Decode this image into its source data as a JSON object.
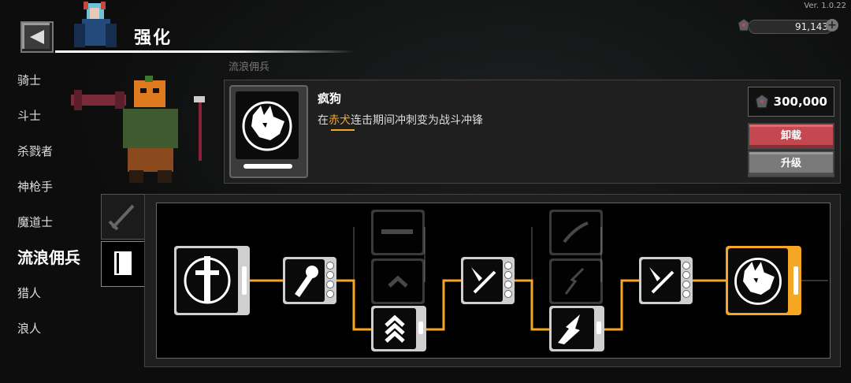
{
  "version": "Ver. 1.0.22",
  "currency": {
    "amount": "91,143",
    "icon": "gem-icon"
  },
  "header": {
    "title": "强化"
  },
  "faded_label": "流浪佣兵",
  "classes": [
    "骑士",
    "斗士",
    "杀戮者",
    "神枪手",
    "魔道士",
    "流浪佣兵",
    "猎人",
    "浪人"
  ],
  "active_class_index": 5,
  "skill": {
    "name": "疯狗",
    "desc_prefix": "在",
    "desc_highlight": "赤犬",
    "desc_suffix": "连击期间冲刺变为战斗冲锋",
    "cost": "300,000",
    "unload_label": "卸载",
    "upgrade_label": "升级"
  },
  "colors": {
    "accent": "#f5a623",
    "unload": "#c5474f",
    "upgrade": "#7a7a7a"
  },
  "tabs": [
    {
      "name": "weapon-tab",
      "icon": "sword-icon",
      "active": false
    },
    {
      "name": "book-tab",
      "icon": "book-icon",
      "active": true
    }
  ],
  "tree": {
    "nodes": [
      {
        "id": "root",
        "icon": "sword-emblem-icon",
        "state": "owned"
      },
      {
        "id": "n1",
        "icon": "torch-icon",
        "state": "owned"
      },
      {
        "id": "n2a",
        "icon": "blade-icon",
        "state": "locked"
      },
      {
        "id": "n2b",
        "icon": "chevron-up-icon",
        "state": "locked"
      },
      {
        "id": "n2c",
        "icon": "chevron-up-icon",
        "state": "owned"
      },
      {
        "id": "n3",
        "icon": "dash-strike-icon",
        "state": "owned"
      },
      {
        "id": "n4a",
        "icon": "slash-icon",
        "state": "locked"
      },
      {
        "id": "n4b",
        "icon": "lightning-icon",
        "state": "locked"
      },
      {
        "id": "n4c",
        "icon": "lightning-icon",
        "state": "owned"
      },
      {
        "id": "n5",
        "icon": "dash-strike-icon",
        "state": "owned"
      },
      {
        "id": "final",
        "icon": "wolf-icon",
        "state": "selected"
      }
    ]
  }
}
